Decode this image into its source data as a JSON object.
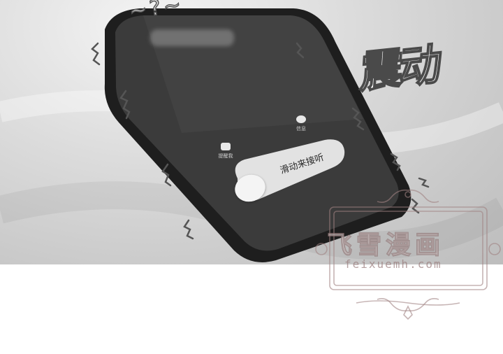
{
  "scene": {
    "caption_top": "~?~",
    "sfx_text": "震动",
    "app_left_label": "提醒我",
    "app_right_label": "信息",
    "slider_label": "滑动来接听"
  },
  "watermark": {
    "title": "飞雪漫画",
    "url": "feixuemh.com"
  },
  "colors": {
    "panel": "#cfcfcf",
    "phone_body": "#1e1e1e",
    "phone_screen": "#3a3a3a",
    "slider": "#e2e2e2",
    "watermark": "#b09a9a"
  }
}
